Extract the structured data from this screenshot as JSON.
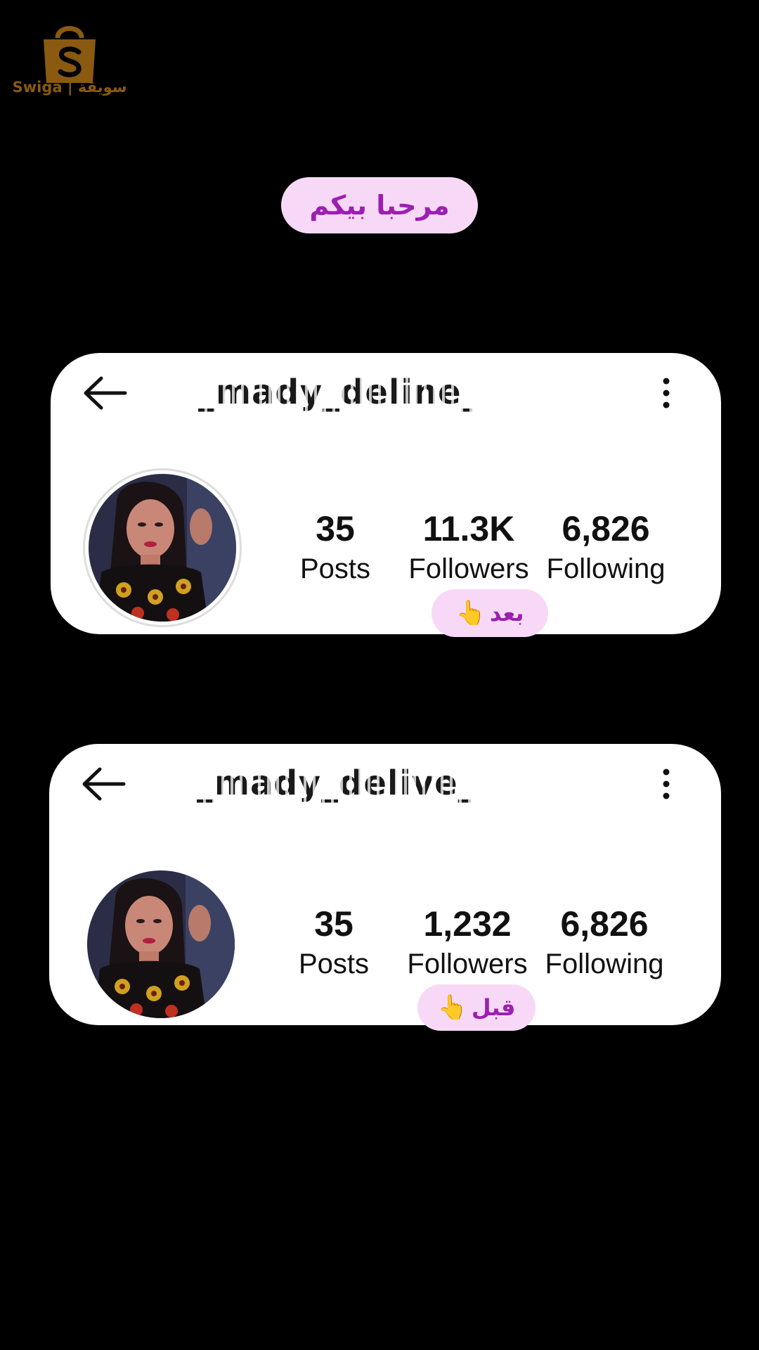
{
  "logo": {
    "text": "Swiga | سويقة",
    "icon": "shopping-bag-icon",
    "color": "#8a5a10"
  },
  "welcome": {
    "text": "مرحبا بيكم"
  },
  "profiles": {
    "after": {
      "username": "_mady_deline_",
      "stats": [
        {
          "value": "35",
          "label": "Posts"
        },
        {
          "value": "11.3K",
          "label": "Followers"
        },
        {
          "value": "6,826",
          "label": "Following"
        }
      ],
      "tag": "بعد",
      "tag_icon": "pointing-hand-icon"
    },
    "before": {
      "username": "_mady_delive_",
      "stats": [
        {
          "value": "35",
          "label": "Posts"
        },
        {
          "value": "1,232",
          "label": "Followers"
        },
        {
          "value": "6,826",
          "label": "Following"
        }
      ],
      "tag": "قبل",
      "tag_icon": "pointing-hand-icon"
    }
  },
  "colors": {
    "background": "#000000",
    "card": "#ffffff",
    "pill_bg": "#f7d9f7",
    "pill_text": "#9b1fb0"
  }
}
